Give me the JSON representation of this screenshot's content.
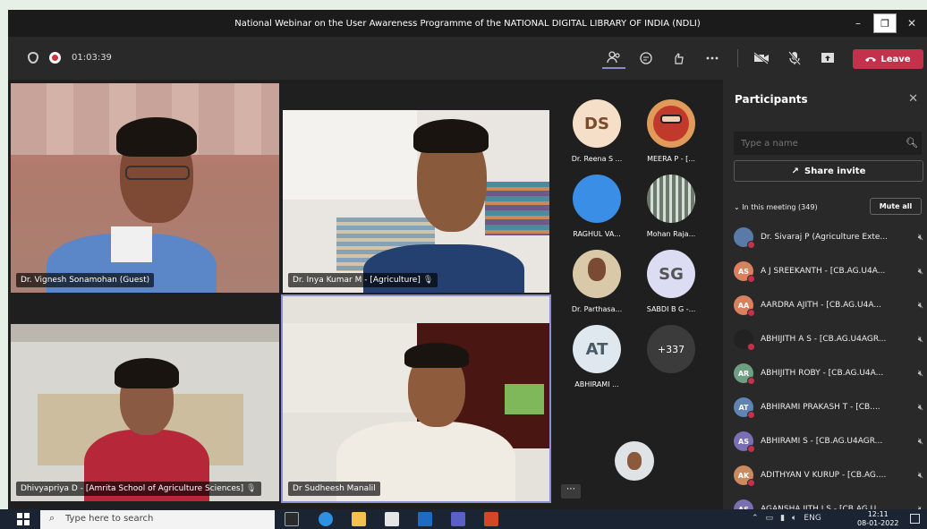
{
  "window": {
    "title": "National Webinar on the User Awareness Programme of the NATIONAL DIGITAL LIBRARY OF INDIA (NDLI)",
    "minimize": "–",
    "maximize": "❐",
    "close": "✕"
  },
  "toolbar": {
    "timer": "01:03:39",
    "leave_label": "Leave"
  },
  "tiles": [
    {
      "name": "Dr. Vignesh Sonamohan (Guest)"
    },
    {
      "name": "Dr. Inya Kumar M - [Agriculture]"
    },
    {
      "name": "Dhivyapriya D - [Amrita School of Agriculture Sciences]"
    },
    {
      "name": "Dr Sudheesh Manalil"
    }
  ],
  "avatars": [
    {
      "initials": "DS",
      "label": "Dr. Reena S ...",
      "color": "#f6dfc8"
    },
    {
      "initials": "",
      "label": "MEERA P - [...",
      "color": "#e09a5a"
    },
    {
      "initials": "",
      "label": "RAGHUL VA...",
      "color": "#3b8ee6"
    },
    {
      "initials": "",
      "label": "Mohan Raja...",
      "color": "#7a8a7a"
    },
    {
      "initials": "",
      "label": "Dr. Parthasa...",
      "color": "#d9c9a8"
    },
    {
      "initials": "SG",
      "label": "SABDI B G -...",
      "color": "#dcdcf2"
    },
    {
      "initials": "AT",
      "label": "ABHIRAMI ...",
      "color": "#dfe8ee"
    },
    {
      "initials": "+337",
      "label": "",
      "color": "#3b3b3b"
    }
  ],
  "panel": {
    "title": "Participants",
    "search_placeholder": "Type a name",
    "share_invite": "Share invite",
    "meeting_header": "In this meeting (349)",
    "mute_all": "Mute all",
    "participants": [
      {
        "initials": "",
        "name": "Dr. Sivaraj P (Agriculture Exte...",
        "color": "#5a7aa8"
      },
      {
        "initials": "AS",
        "name": "A J SREEKANTH - [CB.AG.U4A...",
        "color": "#d9805f"
      },
      {
        "initials": "AA",
        "name": "AARDRA AJITH - [CB.AG.U4A...",
        "color": "#d9805f"
      },
      {
        "initials": "",
        "name": "ABHIJITH A S - [CB.AG.U4AGR...",
        "color": "#222222"
      },
      {
        "initials": "AR",
        "name": "ABHIJITH ROBY - [CB.AG.U4A...",
        "color": "#6f9f83"
      },
      {
        "initials": "AT",
        "name": "ABHIRAMI PRAKASH T - [CB....",
        "color": "#5f84b3"
      },
      {
        "initials": "AS",
        "name": "ABHIRAMI S - [CB.AG.U4AGR...",
        "color": "#7b6fb3"
      },
      {
        "initials": "AK",
        "name": "ADITHYAN V KURUP - [CB.AG....",
        "color": "#c98a5f"
      },
      {
        "initials": "AS",
        "name": "AGANSHA JITH J S - [CB.AG.U...",
        "color": "#7b6fb3"
      }
    ]
  },
  "taskbar": {
    "search_placeholder": "Type here to search",
    "lang": "ENG",
    "time": "12:11",
    "date": "08-01-2022"
  }
}
